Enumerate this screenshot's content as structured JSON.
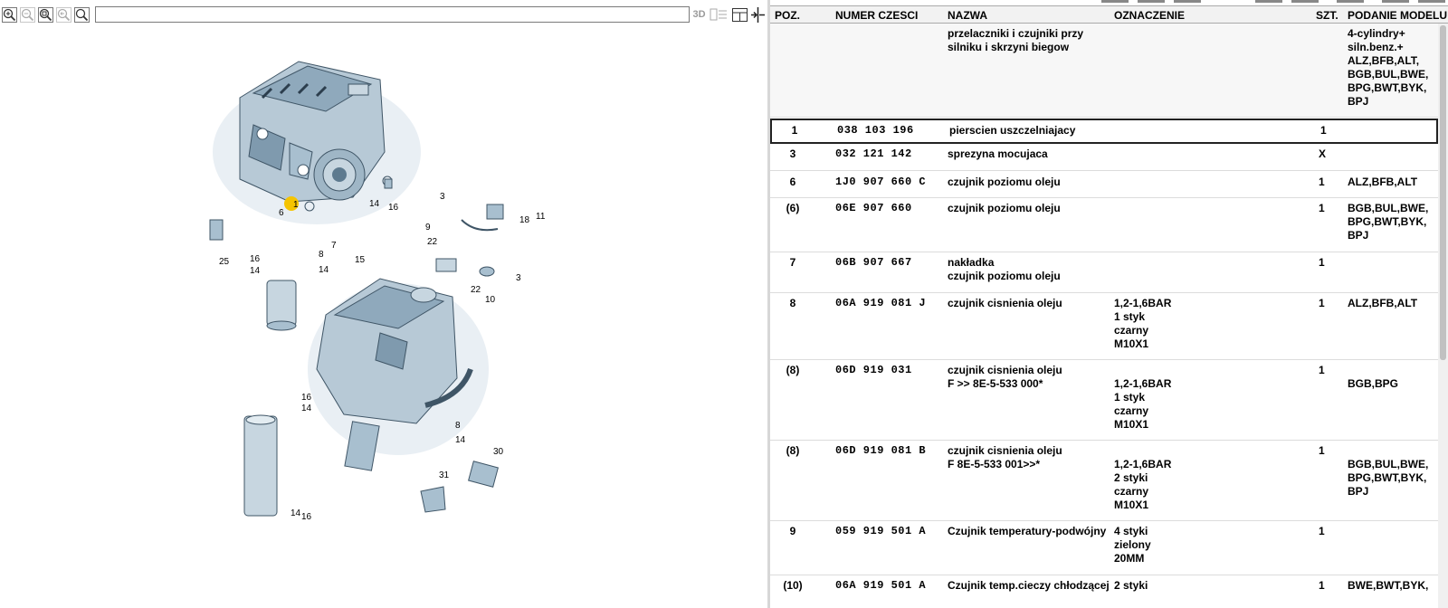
{
  "toolbar": {
    "buttons": [
      {
        "name": "zoom-in-icon"
      },
      {
        "name": "zoom-out-icon"
      },
      {
        "name": "zoom-fit-icon"
      },
      {
        "name": "zoom-back-icon"
      },
      {
        "name": "search-icon"
      }
    ],
    "path_value": "",
    "btn_3d": "3D"
  },
  "table": {
    "columns": {
      "poz": "POZ.",
      "num": "NUMER CZESCI",
      "name": "NAZWA",
      "ozn": "OZNACZENIE",
      "szt": "SZT.",
      "pod": "PODANIE MODELU"
    },
    "header_row": {
      "name": "przelaczniki i czujniki przy\nsilniku i skrzyni biegow",
      "pod": "4-cylindry+\nsiln.benz.+\nALZ,BFB,ALT,\nBGB,BUL,BWE,\nBPG,BWT,BYK,\nBPJ"
    },
    "rows": [
      {
        "poz": "1",
        "num": "038 103 196",
        "name": "pierscien uszczelniajacy",
        "ozn": "",
        "szt": "1",
        "pod": "",
        "selected": true
      },
      {
        "poz": "3",
        "num": "032 121 142",
        "name": "sprezyna mocujaca",
        "ozn": "",
        "szt": "X",
        "pod": ""
      },
      {
        "poz": "6",
        "num": "1J0 907 660 C",
        "name": "czujnik poziomu oleju",
        "ozn": "",
        "szt": "1",
        "pod": "ALZ,BFB,ALT"
      },
      {
        "poz": "(6)",
        "num": "06E 907 660",
        "name": "czujnik poziomu oleju",
        "ozn": "",
        "szt": "1",
        "pod": "BGB,BUL,BWE,\nBPG,BWT,BYK,\nBPJ"
      },
      {
        "poz": "7",
        "num": "06B 907 667",
        "name": "nakładka\nczujnik poziomu oleju",
        "ozn": "",
        "szt": "1",
        "pod": ""
      },
      {
        "poz": "8",
        "num": "06A 919 081 J",
        "name": "czujnik cisnienia oleju",
        "ozn": "1,2-1,6BAR\n1 styk\nczarny\nM10X1",
        "szt": "1",
        "pod": "ALZ,BFB,ALT"
      },
      {
        "poz": "(8)",
        "num": "06D 919 031",
        "name": "czujnik cisnienia oleju\nF            >> 8E-5-533 000*",
        "ozn": "\n1,2-1,6BAR\n1 styk\nczarny\nM10X1",
        "szt": "\n1",
        "pod": "\nBGB,BPG"
      },
      {
        "poz": "(8)",
        "num": "06D 919 081 B",
        "name": "czujnik cisnienia oleju\nF 8E-5-533 001>>*",
        "ozn": "\n1,2-1,6BAR\n2 styki\nczarny\nM10X1",
        "szt": "\n1",
        "pod": "\nBGB,BUL,BWE,\nBPG,BWT,BYK,\nBPJ"
      },
      {
        "poz": "9",
        "num": "059 919 501 A",
        "name": "Czujnik temperatury-podwójny",
        "ozn": "4 styki\nzielony\n20MM",
        "szt": "1",
        "pod": ""
      },
      {
        "poz": "(10)",
        "num": "06A 919 501 A",
        "name": "Czujnik temp.cieczy chłodzącej",
        "ozn": "2 styki",
        "szt": "1",
        "pod": "BWE,BWT,BYK,"
      }
    ]
  },
  "diagram": {
    "callouts": [
      "1",
      "6",
      "14",
      "16",
      "3",
      "9",
      "22",
      "11",
      "18",
      "25",
      "16",
      "14",
      "8",
      "14",
      "7",
      "15",
      "22",
      "10",
      "3",
      "16",
      "14",
      "8",
      "14",
      "30",
      "31",
      "14",
      "16"
    ]
  },
  "colors": {
    "engine_fill": "#b7c9d6",
    "engine_dark": "#5d7a8f",
    "highlight": "#f5c400"
  }
}
